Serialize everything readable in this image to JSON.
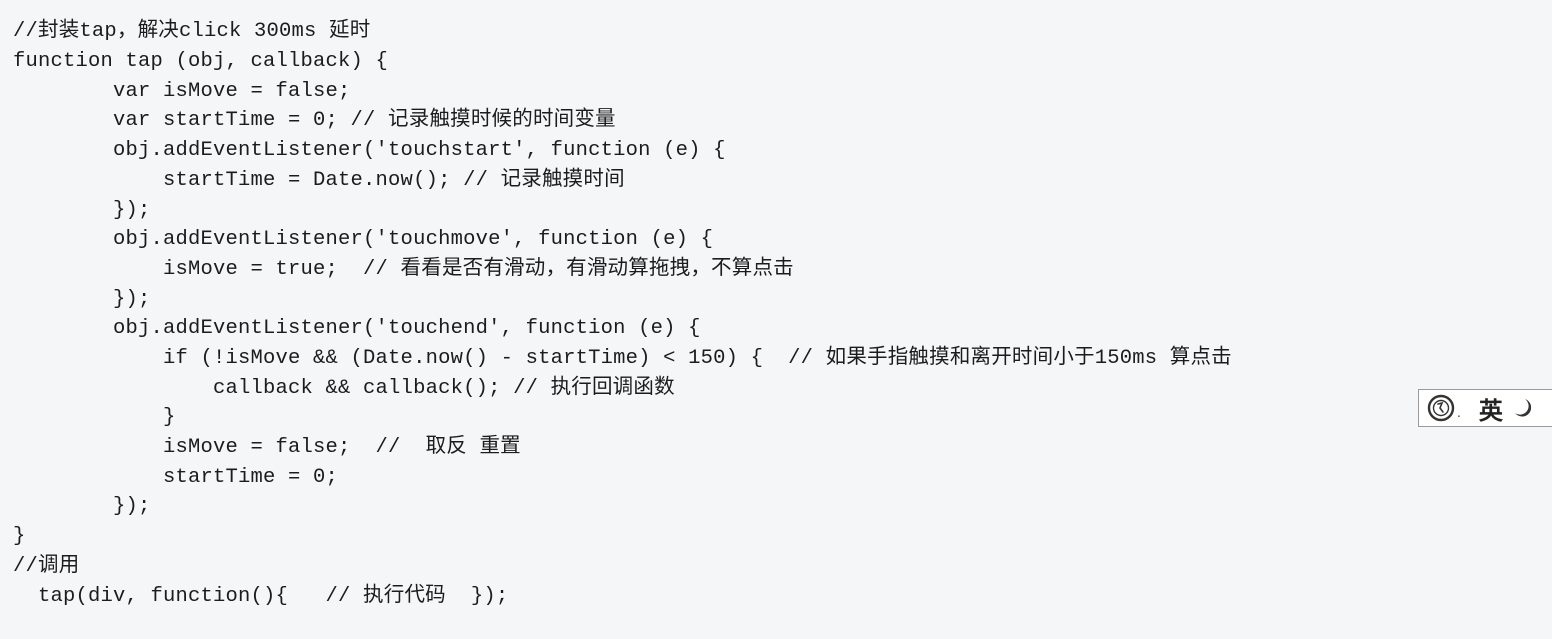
{
  "code": {
    "lines": [
      "//封装tap，解决click 300ms 延时",
      "function tap (obj, callback) {",
      "        var isMove = false;",
      "        var startTime = 0; // 记录触摸时候的时间变量",
      "        obj.addEventListener('touchstart', function (e) {",
      "            startTime = Date.now(); // 记录触摸时间",
      "        });",
      "        obj.addEventListener('touchmove', function (e) {",
      "            isMove = true;  // 看看是否有滑动，有滑动算拖拽，不算点击",
      "        });",
      "        obj.addEventListener('touchend', function (e) {",
      "            if (!isMove && (Date.now() - startTime) < 150) {  // 如果手指触摸和离开时间小于150ms 算点击",
      "                callback && callback(); // 执行回调函数",
      "            }",
      "            isMove = false;  //  取反 重置",
      "            startTime = 0;",
      "        });",
      "}",
      "//调用",
      "  tap(div, function(){   // 执行代码  });"
    ]
  },
  "ime_toolbar": {
    "logo_icon": "sogou-ime-logo-icon",
    "language_label": "英",
    "mode_icon": "moon-icon"
  }
}
